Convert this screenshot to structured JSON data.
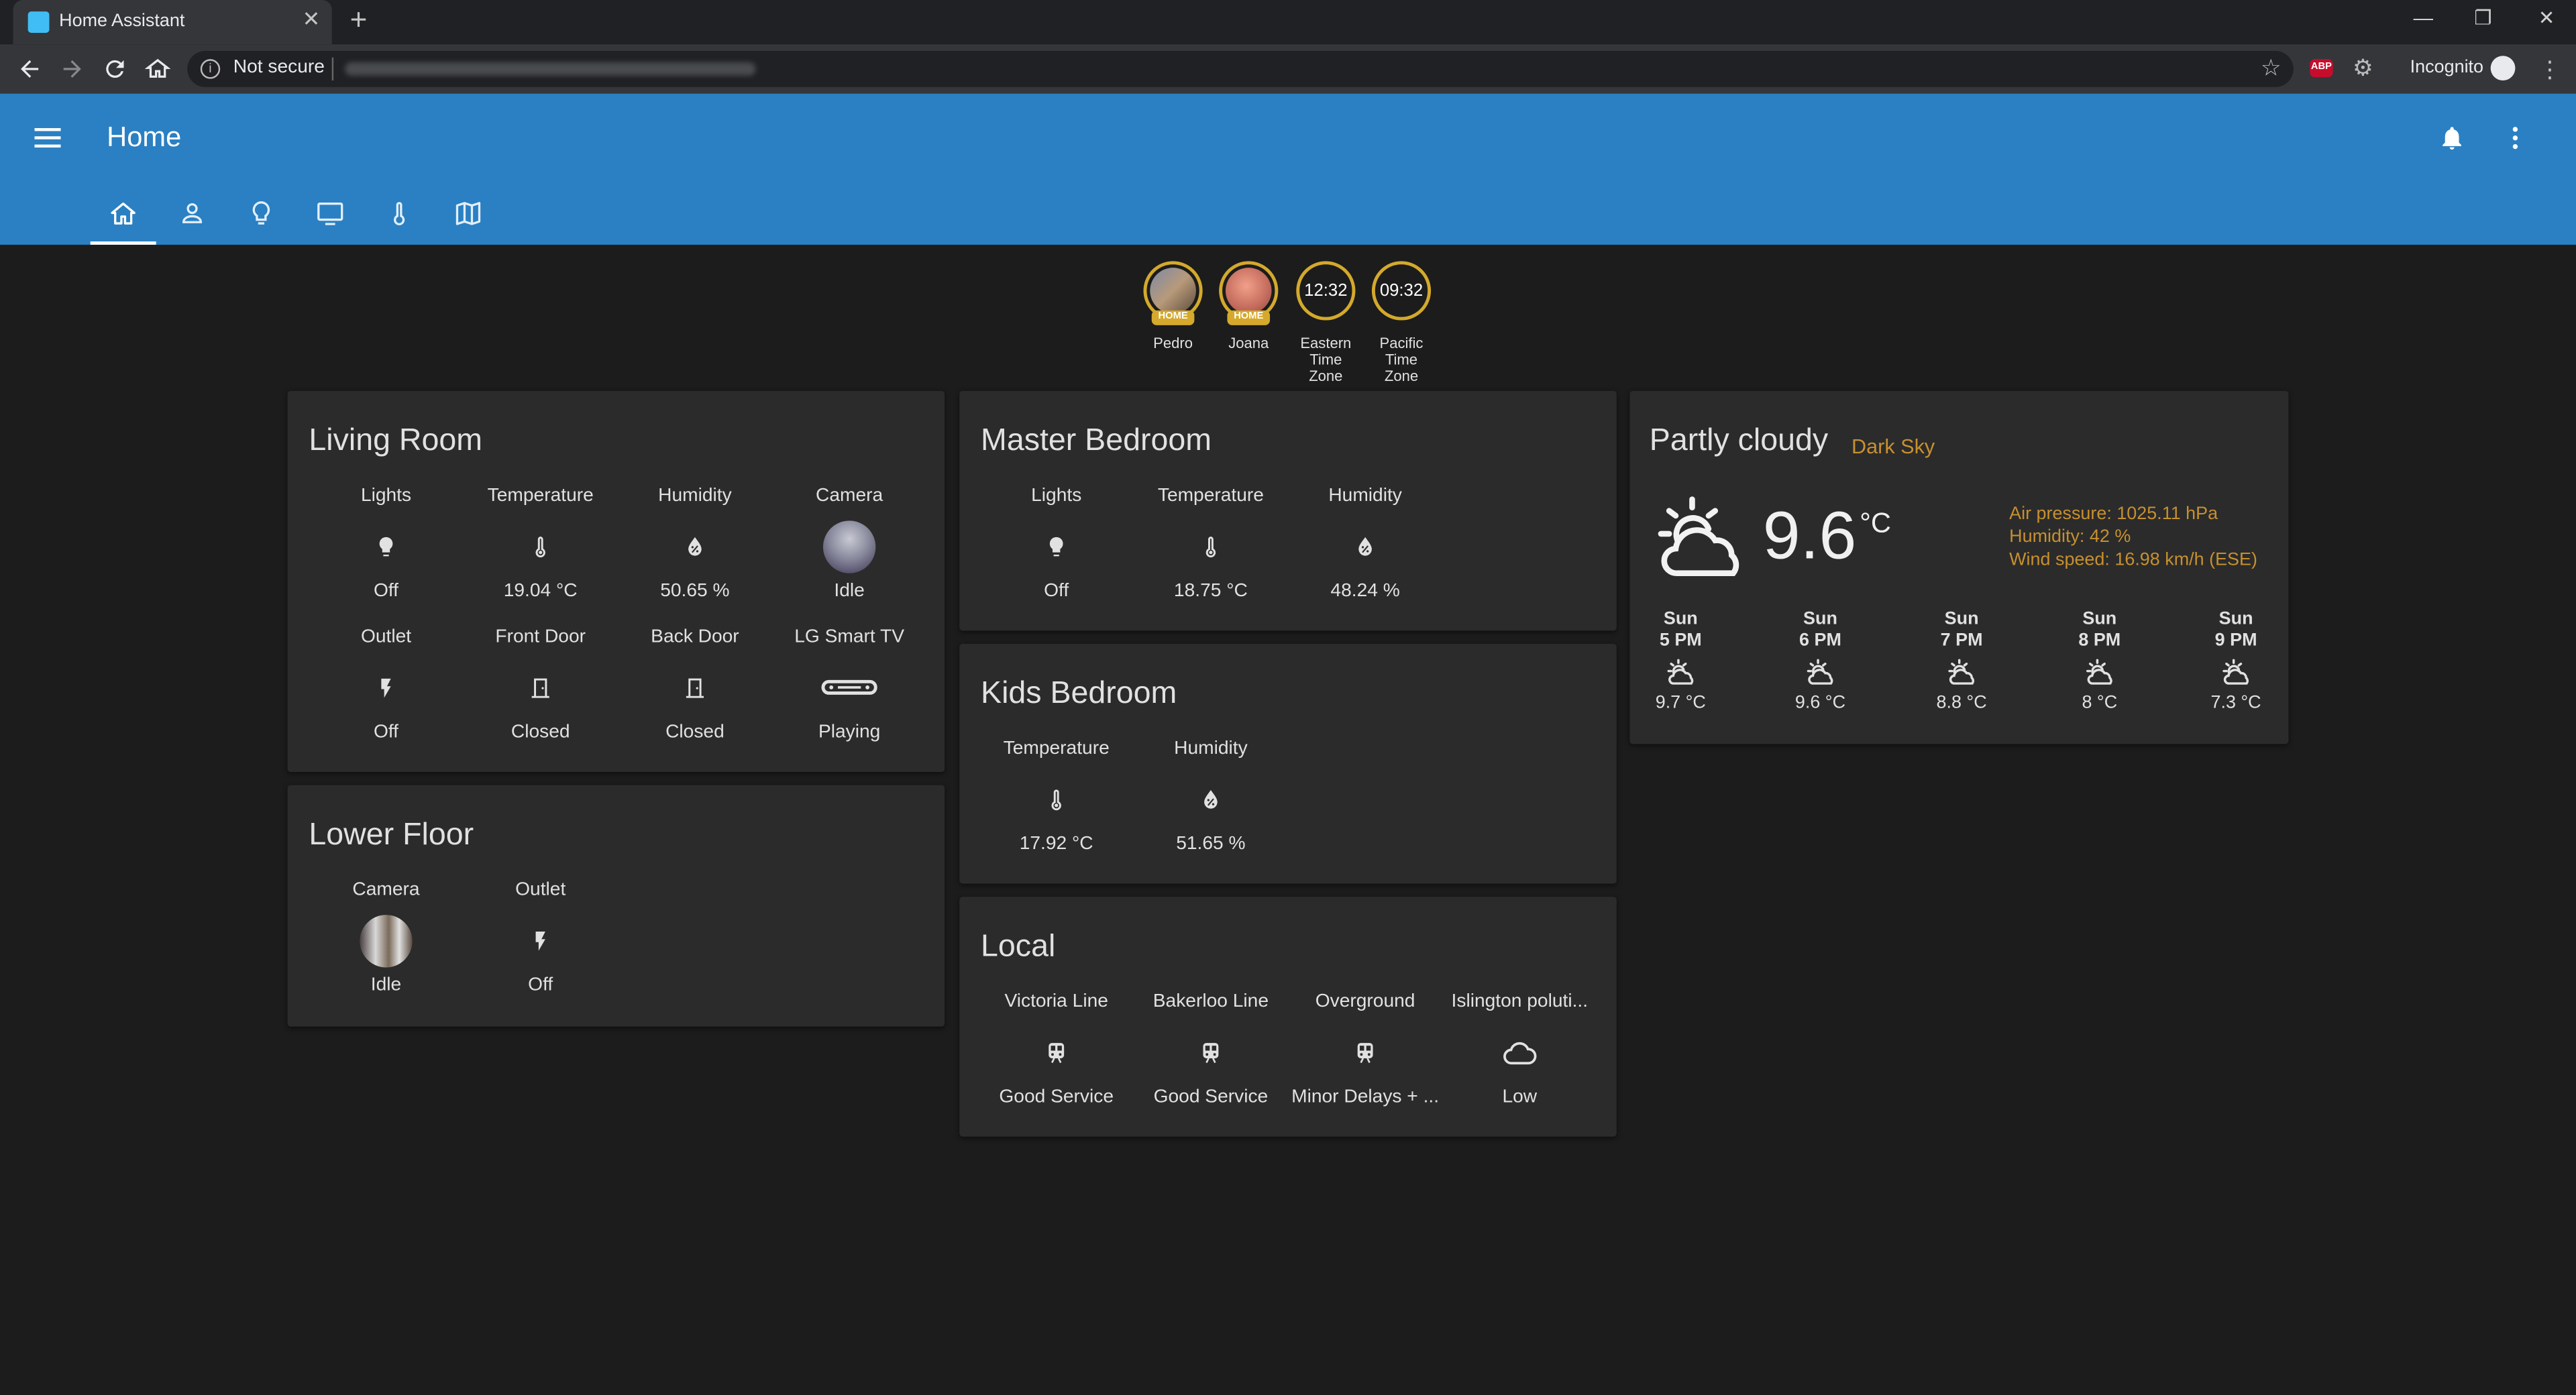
{
  "browser": {
    "tab_title": "Home Assistant",
    "security_label": "Not secure",
    "incognito_label": "Incognito",
    "abp_label": "ABP"
  },
  "header": {
    "title": "Home"
  },
  "view_tabs": [
    "home-icon",
    "person-icon",
    "lightbulb-icon",
    "television-icon",
    "thermometer-icon",
    "map-icon"
  ],
  "badges": [
    {
      "name": "Pedro",
      "label": "HOME"
    },
    {
      "name": "Joana",
      "label": "HOME"
    },
    {
      "name": "Eastern Time Zone",
      "value": "12:32"
    },
    {
      "name": "Pacific Time Zone",
      "value": "09:32"
    }
  ],
  "living_room": {
    "title": "Living Room",
    "entities": [
      {
        "name": "Lights",
        "state": "Off",
        "icon": "lightbulb-icon"
      },
      {
        "name": "Temperature",
        "state": "19.04 °C",
        "icon": "thermometer-icon"
      },
      {
        "name": "Humidity",
        "state": "50.65 %",
        "icon": "water-percent-icon"
      },
      {
        "name": "Camera",
        "state": "Idle",
        "icon": "camera-thumbnail"
      },
      {
        "name": "Outlet",
        "state": "Off",
        "icon": "flash-icon"
      },
      {
        "name": "Front Door",
        "state": "Closed",
        "icon": "door-closed-icon"
      },
      {
        "name": "Back Door",
        "state": "Closed",
        "icon": "door-closed-icon"
      },
      {
        "name": "LG Smart TV",
        "state": "Playing",
        "icon": "speaker-bar-icon"
      }
    ]
  },
  "lower_floor": {
    "title": "Lower Floor",
    "entities": [
      {
        "name": "Camera",
        "state": "Idle",
        "icon": "camera-thumbnail"
      },
      {
        "name": "Outlet",
        "state": "Off",
        "icon": "flash-icon"
      }
    ]
  },
  "master_bedroom": {
    "title": "Master Bedroom",
    "entities": [
      {
        "name": "Lights",
        "state": "Off",
        "icon": "lightbulb-icon"
      },
      {
        "name": "Temperature",
        "state": "18.75 °C",
        "icon": "thermometer-icon"
      },
      {
        "name": "Humidity",
        "state": "48.24 %",
        "icon": "water-percent-icon"
      }
    ]
  },
  "kids_bedroom": {
    "title": "Kids Bedroom",
    "entities": [
      {
        "name": "Temperature",
        "state": "17.92 °C",
        "icon": "thermometer-icon"
      },
      {
        "name": "Humidity",
        "state": "51.65 %",
        "icon": "water-percent-icon"
      }
    ]
  },
  "local": {
    "title": "Local",
    "entities": [
      {
        "name": "Victoria Line",
        "state": "Good Service",
        "icon": "train-icon"
      },
      {
        "name": "Bakerloo Line",
        "state": "Good Service",
        "icon": "train-icon"
      },
      {
        "name": "Overground",
        "state": "Minor Delays + ...",
        "icon": "train-icon"
      },
      {
        "name": "Islington poluti...",
        "state": "Low",
        "icon": "cloud-icon"
      }
    ]
  },
  "weather": {
    "condition": "Partly cloudy",
    "source": "Dark Sky",
    "temperature": "9.6",
    "unit": "°C",
    "pressure": "Air pressure: 1025.11 hPa",
    "humidity": "Humidity: 42 %",
    "wind": "Wind speed: 16.98 km/h (ESE)",
    "forecast": [
      {
        "day": "Sun",
        "time": "5 PM",
        "temp": "9.7 °C"
      },
      {
        "day": "Sun",
        "time": "6 PM",
        "temp": "9.6 °C"
      },
      {
        "day": "Sun",
        "time": "7 PM",
        "temp": "8.8 °C"
      },
      {
        "day": "Sun",
        "time": "8 PM",
        "temp": "8 °C"
      },
      {
        "day": "Sun",
        "time": "9 PM",
        "temp": "7.3 °C"
      }
    ]
  },
  "colors": {
    "header": "#2a80c2",
    "background": "#1c1c1c",
    "card": "#2b2b2b",
    "badge_accent": "#d4a92c",
    "weather_accent": "#c7902f"
  }
}
